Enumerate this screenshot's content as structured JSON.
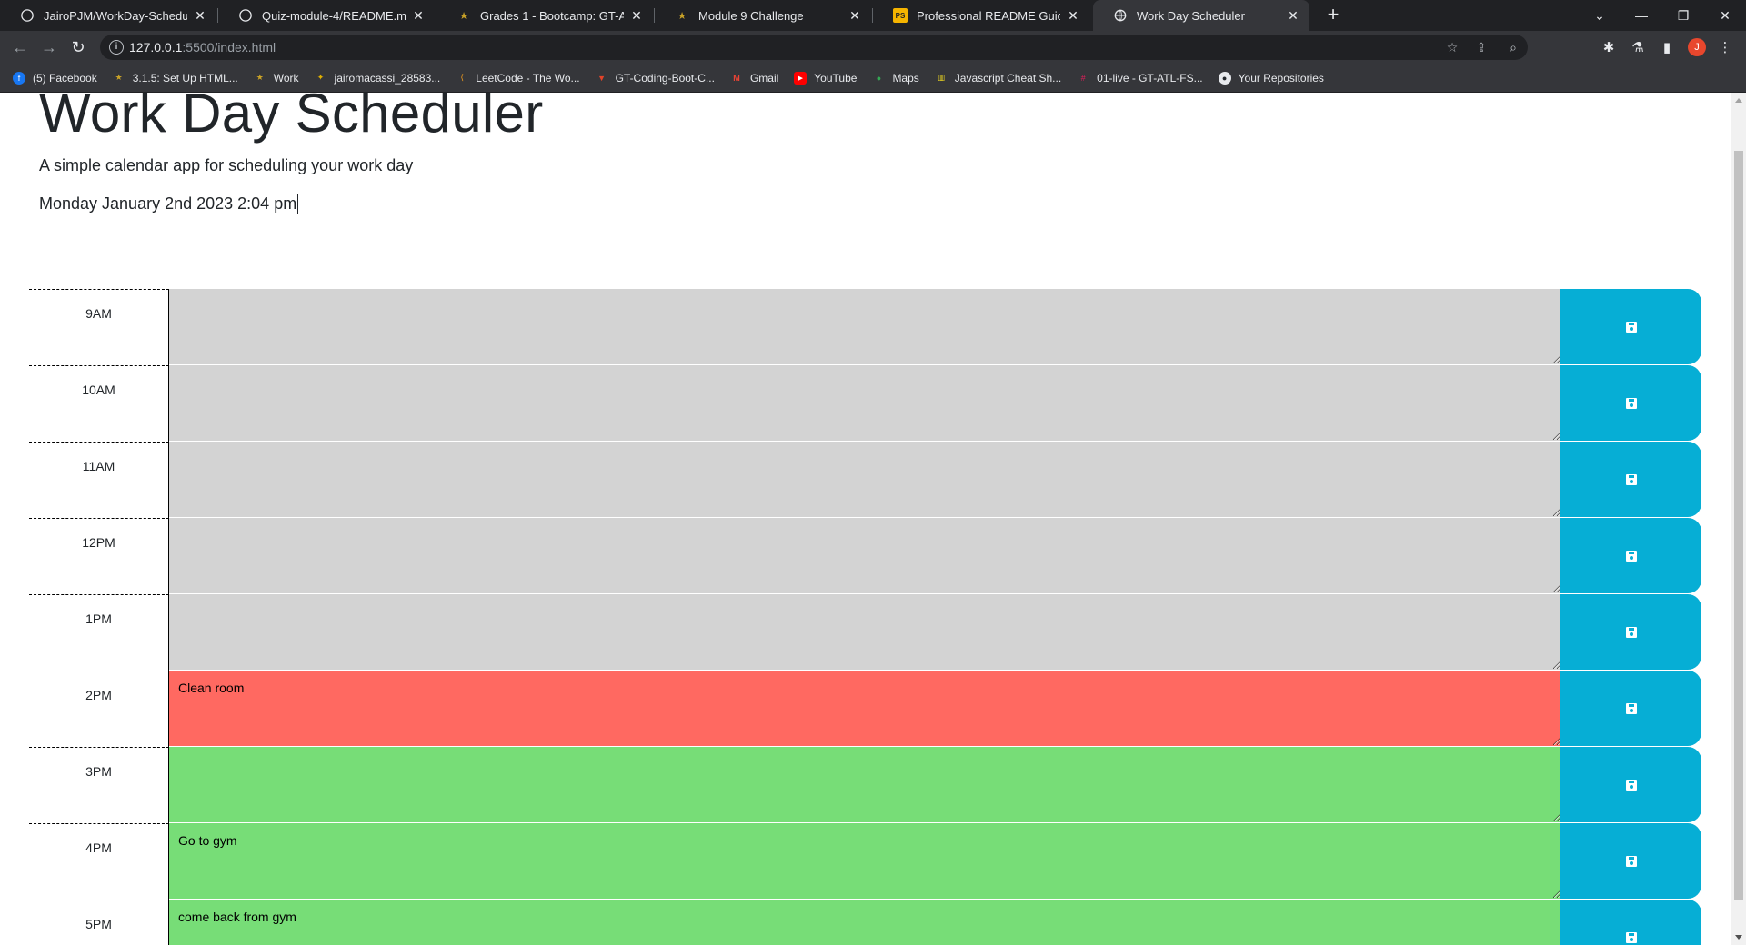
{
  "browser": {
    "tabs": [
      {
        "title": "JairoPJM/WorkDay-Schedule-Me",
        "icon": "github-icon"
      },
      {
        "title": "Quiz-module-4/README.md at m",
        "icon": "github-icon"
      },
      {
        "title": "Grades 1 - Bootcamp: GT-ATL-FS",
        "icon": "bootcamp-icon"
      },
      {
        "title": "Module 9 Challenge",
        "icon": "bootcamp-icon"
      },
      {
        "title": "Professional README Guide | The",
        "icon": "readme-guide-icon"
      },
      {
        "title": "Work Day Scheduler",
        "icon": "globe-icon",
        "active": true
      }
    ],
    "close_glyph": "✕",
    "newtab_glyph": "+",
    "address": {
      "host": "127.0.0.1",
      "path": ":5500/index.html"
    },
    "profile_initial": "J",
    "bookmarks": [
      {
        "label": "(5) Facebook",
        "icon": "facebook-icon",
        "color": "#1877f2"
      },
      {
        "label": "3.1.5: Set Up HTML...",
        "icon": "bootcamp-icon",
        "color": "#6b5a2e"
      },
      {
        "label": "Work",
        "icon": "bootcamp-icon",
        "color": "#6b5a2e"
      },
      {
        "label": "jairomacassi_28583...",
        "icon": "bootcamp-icon",
        "color": "#c9a227"
      },
      {
        "label": "LeetCode - The Wo...",
        "icon": "leetcode-icon",
        "color": "#f89f1b"
      },
      {
        "label": "GT-Coding-Boot-C...",
        "icon": "gitlab-icon",
        "color": "#e24329"
      },
      {
        "label": "Gmail",
        "icon": "gmail-icon",
        "color": "#ea4335"
      },
      {
        "label": "YouTube",
        "icon": "youtube-icon",
        "color": "#ff0000"
      },
      {
        "label": "Maps",
        "icon": "maps-icon",
        "color": "#34a853"
      },
      {
        "label": "Javascript Cheat Sh...",
        "icon": "cheatsheet-icon",
        "color": "#f7df1e"
      },
      {
        "label": "01-live - GT-ATL-FS...",
        "icon": "slack-icon",
        "color": "#4a154b"
      },
      {
        "label": "Your Repositories",
        "icon": "github-icon",
        "color": "#24292e"
      }
    ]
  },
  "page": {
    "title": "Work Day Scheduler",
    "lead": "A simple calendar app for scheduling your work day",
    "current_day": "Monday January 2nd 2023 2:04 pm"
  },
  "timeblocks": [
    {
      "hour": "9AM",
      "text": "",
      "state": "past"
    },
    {
      "hour": "10AM",
      "text": "",
      "state": "past"
    },
    {
      "hour": "11AM",
      "text": "",
      "state": "past"
    },
    {
      "hour": "12PM",
      "text": "",
      "state": "past"
    },
    {
      "hour": "1PM",
      "text": "",
      "state": "past"
    },
    {
      "hour": "2PM",
      "text": "Clean room",
      "state": "present"
    },
    {
      "hour": "3PM",
      "text": "",
      "state": "future"
    },
    {
      "hour": "4PM",
      "text": "Go to gym",
      "state": "future"
    },
    {
      "hour": "5PM",
      "text": "come back from gym",
      "state": "future"
    }
  ],
  "colors": {
    "past": "#d3d3d3",
    "present": "#ff6961",
    "future": "#77dd77",
    "save_button": "#06aed5"
  }
}
